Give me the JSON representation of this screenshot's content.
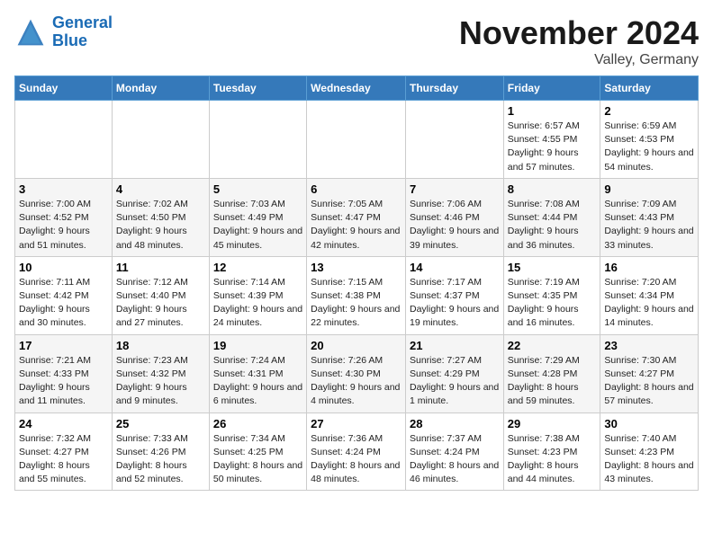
{
  "header": {
    "logo_line1": "General",
    "logo_line2": "Blue",
    "month_title": "November 2024",
    "subtitle": "Valley, Germany"
  },
  "days_of_week": [
    "Sunday",
    "Monday",
    "Tuesday",
    "Wednesday",
    "Thursday",
    "Friday",
    "Saturday"
  ],
  "weeks": [
    [
      {
        "day": "",
        "info": ""
      },
      {
        "day": "",
        "info": ""
      },
      {
        "day": "",
        "info": ""
      },
      {
        "day": "",
        "info": ""
      },
      {
        "day": "",
        "info": ""
      },
      {
        "day": "1",
        "info": "Sunrise: 6:57 AM\nSunset: 4:55 PM\nDaylight: 9 hours and 57 minutes."
      },
      {
        "day": "2",
        "info": "Sunrise: 6:59 AM\nSunset: 4:53 PM\nDaylight: 9 hours and 54 minutes."
      }
    ],
    [
      {
        "day": "3",
        "info": "Sunrise: 7:00 AM\nSunset: 4:52 PM\nDaylight: 9 hours and 51 minutes."
      },
      {
        "day": "4",
        "info": "Sunrise: 7:02 AM\nSunset: 4:50 PM\nDaylight: 9 hours and 48 minutes."
      },
      {
        "day": "5",
        "info": "Sunrise: 7:03 AM\nSunset: 4:49 PM\nDaylight: 9 hours and 45 minutes."
      },
      {
        "day": "6",
        "info": "Sunrise: 7:05 AM\nSunset: 4:47 PM\nDaylight: 9 hours and 42 minutes."
      },
      {
        "day": "7",
        "info": "Sunrise: 7:06 AM\nSunset: 4:46 PM\nDaylight: 9 hours and 39 minutes."
      },
      {
        "day": "8",
        "info": "Sunrise: 7:08 AM\nSunset: 4:44 PM\nDaylight: 9 hours and 36 minutes."
      },
      {
        "day": "9",
        "info": "Sunrise: 7:09 AM\nSunset: 4:43 PM\nDaylight: 9 hours and 33 minutes."
      }
    ],
    [
      {
        "day": "10",
        "info": "Sunrise: 7:11 AM\nSunset: 4:42 PM\nDaylight: 9 hours and 30 minutes."
      },
      {
        "day": "11",
        "info": "Sunrise: 7:12 AM\nSunset: 4:40 PM\nDaylight: 9 hours and 27 minutes."
      },
      {
        "day": "12",
        "info": "Sunrise: 7:14 AM\nSunset: 4:39 PM\nDaylight: 9 hours and 24 minutes."
      },
      {
        "day": "13",
        "info": "Sunrise: 7:15 AM\nSunset: 4:38 PM\nDaylight: 9 hours and 22 minutes."
      },
      {
        "day": "14",
        "info": "Sunrise: 7:17 AM\nSunset: 4:37 PM\nDaylight: 9 hours and 19 minutes."
      },
      {
        "day": "15",
        "info": "Sunrise: 7:19 AM\nSunset: 4:35 PM\nDaylight: 9 hours and 16 minutes."
      },
      {
        "day": "16",
        "info": "Sunrise: 7:20 AM\nSunset: 4:34 PM\nDaylight: 9 hours and 14 minutes."
      }
    ],
    [
      {
        "day": "17",
        "info": "Sunrise: 7:21 AM\nSunset: 4:33 PM\nDaylight: 9 hours and 11 minutes."
      },
      {
        "day": "18",
        "info": "Sunrise: 7:23 AM\nSunset: 4:32 PM\nDaylight: 9 hours and 9 minutes."
      },
      {
        "day": "19",
        "info": "Sunrise: 7:24 AM\nSunset: 4:31 PM\nDaylight: 9 hours and 6 minutes."
      },
      {
        "day": "20",
        "info": "Sunrise: 7:26 AM\nSunset: 4:30 PM\nDaylight: 9 hours and 4 minutes."
      },
      {
        "day": "21",
        "info": "Sunrise: 7:27 AM\nSunset: 4:29 PM\nDaylight: 9 hours and 1 minute."
      },
      {
        "day": "22",
        "info": "Sunrise: 7:29 AM\nSunset: 4:28 PM\nDaylight: 8 hours and 59 minutes."
      },
      {
        "day": "23",
        "info": "Sunrise: 7:30 AM\nSunset: 4:27 PM\nDaylight: 8 hours and 57 minutes."
      }
    ],
    [
      {
        "day": "24",
        "info": "Sunrise: 7:32 AM\nSunset: 4:27 PM\nDaylight: 8 hours and 55 minutes."
      },
      {
        "day": "25",
        "info": "Sunrise: 7:33 AM\nSunset: 4:26 PM\nDaylight: 8 hours and 52 minutes."
      },
      {
        "day": "26",
        "info": "Sunrise: 7:34 AM\nSunset: 4:25 PM\nDaylight: 8 hours and 50 minutes."
      },
      {
        "day": "27",
        "info": "Sunrise: 7:36 AM\nSunset: 4:24 PM\nDaylight: 8 hours and 48 minutes."
      },
      {
        "day": "28",
        "info": "Sunrise: 7:37 AM\nSunset: 4:24 PM\nDaylight: 8 hours and 46 minutes."
      },
      {
        "day": "29",
        "info": "Sunrise: 7:38 AM\nSunset: 4:23 PM\nDaylight: 8 hours and 44 minutes."
      },
      {
        "day": "30",
        "info": "Sunrise: 7:40 AM\nSunset: 4:23 PM\nDaylight: 8 hours and 43 minutes."
      }
    ]
  ]
}
